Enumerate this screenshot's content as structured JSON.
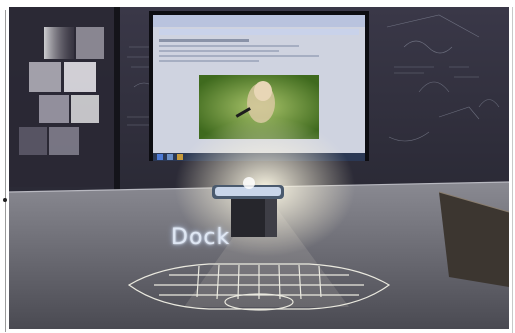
{
  "scene": {
    "label": "Dock",
    "objects": [
      "monitor",
      "video-player",
      "taskbar",
      "chalkboard-wall",
      "phone-dock",
      "projected-keyboard",
      "desk",
      "wall-tiles"
    ]
  },
  "colors": {
    "wall": "#2a2a36",
    "desk": "#6c6c74",
    "screen_glow": "#cfd8ff",
    "video_green": "#5f8f2e",
    "keyboard_glow": "#f2f1e6",
    "beam": "#fff6d8"
  }
}
